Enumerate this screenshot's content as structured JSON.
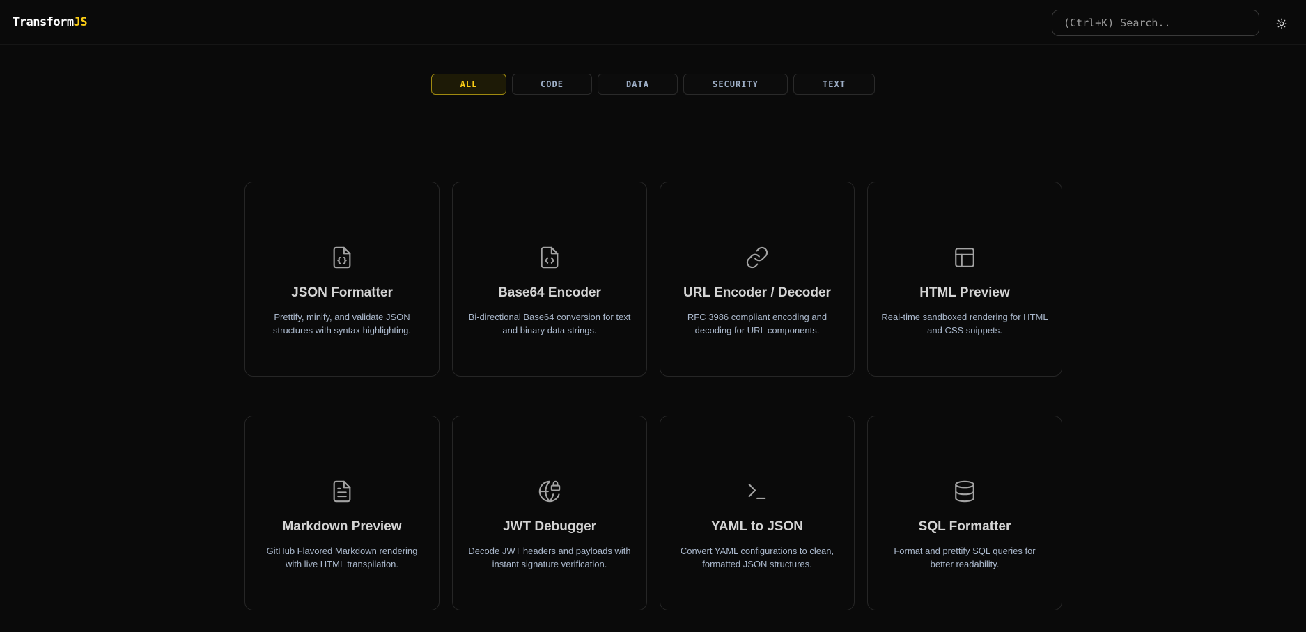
{
  "header": {
    "logo_main": "Transform",
    "logo_accent": "JS",
    "search_placeholder": "(Ctrl+K) Search..",
    "theme_icon": "sun-icon"
  },
  "tabs": [
    {
      "label": "ALL",
      "active": true
    },
    {
      "label": "CODE",
      "active": false
    },
    {
      "label": "DATA",
      "active": false
    },
    {
      "label": "SECURITY",
      "active": false
    },
    {
      "label": "TEXT",
      "active": false
    }
  ],
  "tools": [
    {
      "icon": "file-json-icon",
      "title": "JSON Formatter",
      "description": "Prettify, minify, and validate JSON structures with syntax highlighting."
    },
    {
      "icon": "file-code-icon",
      "title": "Base64 Encoder",
      "description": "Bi-directional Base64 conversion for text and binary data strings."
    },
    {
      "icon": "link-icon",
      "title": "URL Encoder / Decoder",
      "description": "RFC 3986 compliant encoding and decoding for URL components."
    },
    {
      "icon": "layout-icon",
      "title": "HTML Preview",
      "description": "Real-time sandboxed rendering for HTML and CSS snippets."
    },
    {
      "icon": "file-text-icon",
      "title": "Markdown Preview",
      "description": "GitHub Flavored Markdown rendering with live HTML transpilation."
    },
    {
      "icon": "globe-lock-icon",
      "title": "JWT Debugger",
      "description": "Decode JWT headers and payloads with instant signature verification."
    },
    {
      "icon": "terminal-icon",
      "title": "YAML to JSON",
      "description": "Convert YAML configurations to clean, formatted JSON structures."
    },
    {
      "icon": "database-icon",
      "title": "SQL Formatter",
      "description": "Format and prettify SQL queries for better readability."
    }
  ],
  "colors": {
    "accent": "#facc15",
    "background": "#0a0a0a",
    "card_border": "#262626"
  }
}
